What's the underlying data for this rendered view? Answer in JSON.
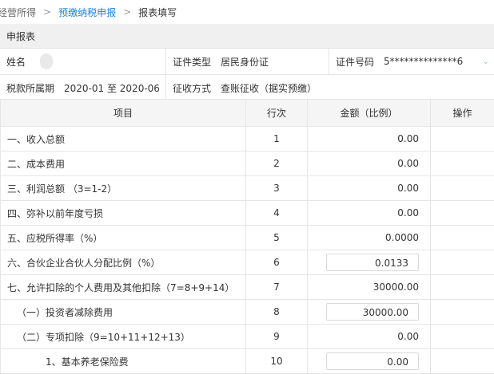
{
  "breadcrumb": {
    "items": [
      "经营所得",
      "预缴纳税申报",
      "报表填写"
    ],
    "separator": ">"
  },
  "sheet": {
    "title": "申报表"
  },
  "info": {
    "name_label": "姓名",
    "name_value": "",
    "id_type_label": "证件类型",
    "id_type_value": "居民身份证",
    "id_no_label": "证件号码",
    "id_no_value": "5**************6",
    "period_label": "税款所属期",
    "period_value": "2020-01 至 2020-06",
    "collection_label": "征收方式",
    "collection_value": "查账征收（据实预缴）"
  },
  "table": {
    "headers": [
      "项目",
      "行次",
      "金额（比例）",
      "操作"
    ],
    "rows": [
      {
        "item": "一、收入总额",
        "line": "1",
        "amount": "0.00",
        "editable": false,
        "indent": 0
      },
      {
        "item": "二、成本费用",
        "line": "2",
        "amount": "0.00",
        "editable": false,
        "indent": 0
      },
      {
        "item": "三、利润总额 （3=1-2）",
        "line": "3",
        "amount": "0.00",
        "editable": false,
        "indent": 0
      },
      {
        "item": "四、弥补以前年度亏损",
        "line": "4",
        "amount": "0.00",
        "editable": false,
        "indent": 0
      },
      {
        "item": "五、应税所得率（%）",
        "line": "5",
        "amount": "0.0000",
        "editable": false,
        "indent": 0
      },
      {
        "item": "六、合伙企业合伙人分配比例（%）",
        "line": "6",
        "amount": "0.0133",
        "editable": true,
        "indent": 0
      },
      {
        "item": "七、允许扣除的个人费用及其他扣除（7=8+9+14）",
        "line": "7",
        "amount": "30000.00",
        "editable": false,
        "indent": 0
      },
      {
        "item": "（一）投资者减除费用",
        "line": "8",
        "amount": "30000.00",
        "editable": true,
        "indent": 1
      },
      {
        "item": "（二）专项扣除（9=10+11+12+13）",
        "line": "9",
        "amount": "0.00",
        "editable": false,
        "indent": 1
      },
      {
        "item": "1、基本养老保险费",
        "line": "10",
        "amount": "0.00",
        "editable": true,
        "indent": 2
      }
    ]
  },
  "colors": {
    "link": "#1a7fd8",
    "header_bg": "#f0f0f0",
    "border": "#e6e6e6"
  }
}
